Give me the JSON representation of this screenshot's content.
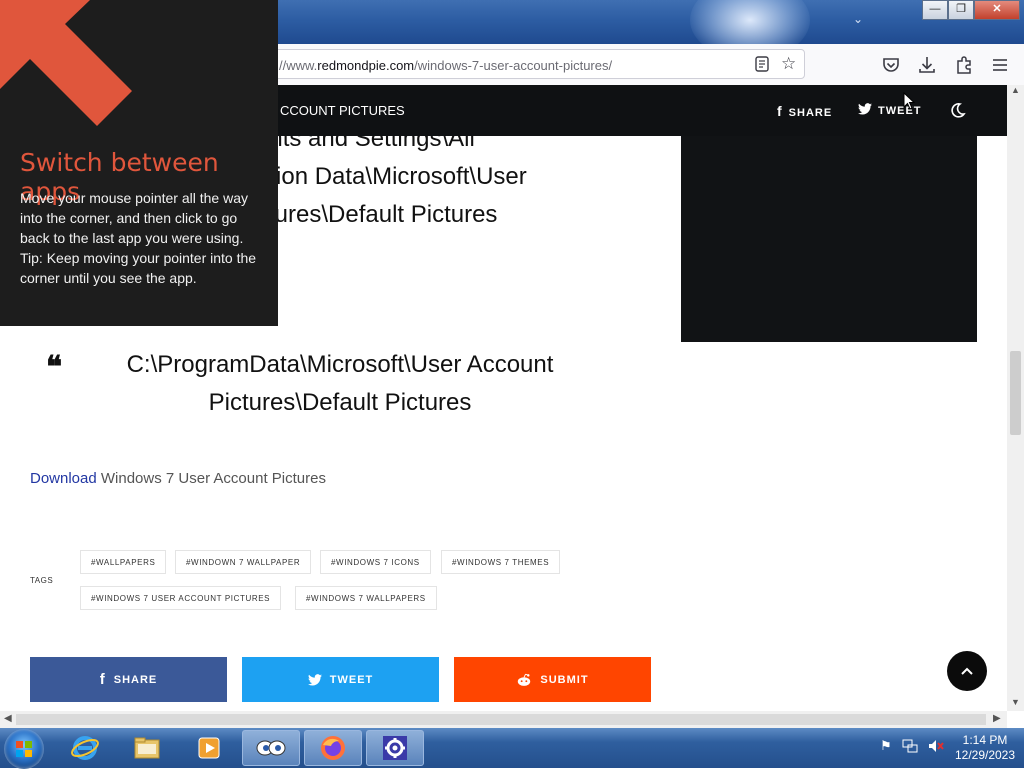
{
  "browser": {
    "url_prefix": "//www.",
    "url_host": "redmondpie.com",
    "url_path": "/windows-7-user-account-pictures/",
    "tab_list_icon": "chevron-down-icon",
    "toolbar_icons": [
      "pocket-icon",
      "download-icon",
      "extensions-icon",
      "menu-icon"
    ],
    "window_buttons": [
      "minimize",
      "restore",
      "close"
    ]
  },
  "site_header": {
    "crumb": "CCOUNT PICTURES",
    "share_label": "SHARE",
    "tweet_label": "TWEET"
  },
  "article": {
    "path_fragment": "ents and Settings\\All\nation Data\\Microsoft\\User\nctures\\Default Pictures",
    "quote": "C:\\ProgramData\\Microsoft\\User Account Pictures\\Default Pictures",
    "download_link": "Download",
    "download_text": " Windows 7 User Account Pictures",
    "tags_label": "TAGS",
    "tags": [
      "#WALLPAPERS",
      "#WINDOWN 7 WALLPAPER",
      "#WINDOWS 7 ICONS",
      "#WINDOWS 7 THEMES",
      "#WINDOWS 7 USER ACCOUNT PICTURES",
      "#WINDOWS 7 WALLPAPERS"
    ],
    "share_buttons": [
      {
        "label": "SHARE",
        "color": "#3b5998"
      },
      {
        "label": "TWEET",
        "color": "#1da1f2"
      },
      {
        "label": "SUBMIT",
        "color": "#ff4500"
      }
    ]
  },
  "tip": {
    "title": "Switch between apps",
    "body_line1": "Move your mouse pointer all the way into the corner, and then click to go back to the last app you were using.",
    "body_line2": "Tip: Keep moving your pointer into the corner until you see the app.",
    "accent": "#e0563c"
  },
  "taskbar": {
    "apps": [
      "internet-explorer",
      "file-explorer",
      "media-player",
      "eyes-app",
      "firefox",
      "settings-app"
    ],
    "time": "1:14 PM",
    "date": "12/29/2023"
  }
}
